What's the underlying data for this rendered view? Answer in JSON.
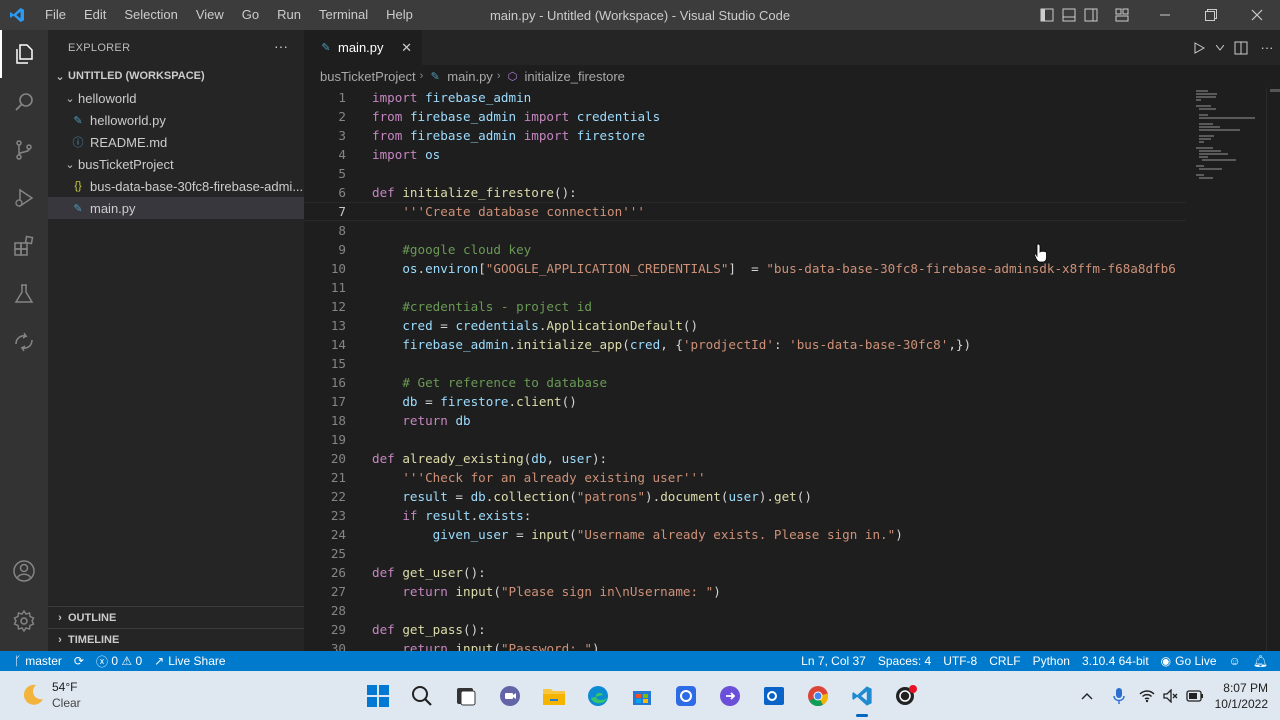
{
  "window": {
    "title": "main.py - Untitled (Workspace) - Visual Studio Code"
  },
  "menu": [
    "File",
    "Edit",
    "Selection",
    "View",
    "Go",
    "Run",
    "Terminal",
    "Help"
  ],
  "sidebar": {
    "title": "EXPLORER",
    "workspace": "UNTITLED (WORKSPACE)",
    "folders": [
      {
        "name": "helloworld",
        "files": [
          {
            "name": "helloworld.py",
            "type": "py"
          },
          {
            "name": "README.md",
            "type": "md"
          }
        ]
      },
      {
        "name": "busTicketProject",
        "files": [
          {
            "name": "bus-data-base-30fc8-firebase-admi...",
            "type": "json"
          },
          {
            "name": "main.py",
            "type": "py",
            "selected": true
          }
        ]
      }
    ],
    "outline": "OUTLINE",
    "timeline": "TIMELINE"
  },
  "tab": {
    "label": "main.py"
  },
  "breadcrumb": {
    "folder": "busTicketProject",
    "file": "main.py",
    "symbol": "initialize_firestore"
  },
  "code": [
    "import firebase_admin",
    "from firebase_admin import credentials",
    "from firebase_admin import firestore",
    "import os",
    "",
    "def initialize_firestore():",
    "    '''Create database connection'''",
    "",
    "    #google cloud key",
    "    os.environ[\"GOOGLE_APPLICATION_CREDENTIALS\"]  = \"bus-data-base-30fc8-firebase-adminsdk-x8ffm-f68a8dfb6",
    "",
    "    #credentials - project id",
    "    cred = credentials.ApplicationDefault()",
    "    firebase_admin.initialize_app(cred, {'prodjectId': 'bus-data-base-30fc8',})",
    "",
    "    # Get reference to database",
    "    db = firestore.client()",
    "    return db",
    "",
    "def already_existing(db, user):",
    "    '''Check for an already existing user'''",
    "    result = db.collection(\"patrons\").document(user).get()",
    "    if result.exists:",
    "        given_user = input(\"Username already exists. Please sign in.\")",
    "",
    "def get_user():",
    "    return input(\"Please sign in\\nUsername: \")",
    "",
    "def get_pass():",
    "    return input(\"Password: \")"
  ],
  "current_line": 7,
  "status": {
    "branch": "master",
    "errors": "0",
    "warnings": "0",
    "live_share": "Live Share",
    "position": "Ln 7, Col 37",
    "spaces": "Spaces: 4",
    "encoding": "UTF-8",
    "eol": "CRLF",
    "language": "Python",
    "interpreter": "3.10.4 64-bit",
    "go_live": "Go Live"
  },
  "taskbar": {
    "temp": "54°F",
    "weather": "Clear",
    "time": "8:07 PM",
    "date": "10/1/2022"
  },
  "colors": {
    "accent": "#007acc",
    "titlebar": "#3c3c3c",
    "editor_bg": "#1e1e1e",
    "sidebar_bg": "#252526"
  }
}
